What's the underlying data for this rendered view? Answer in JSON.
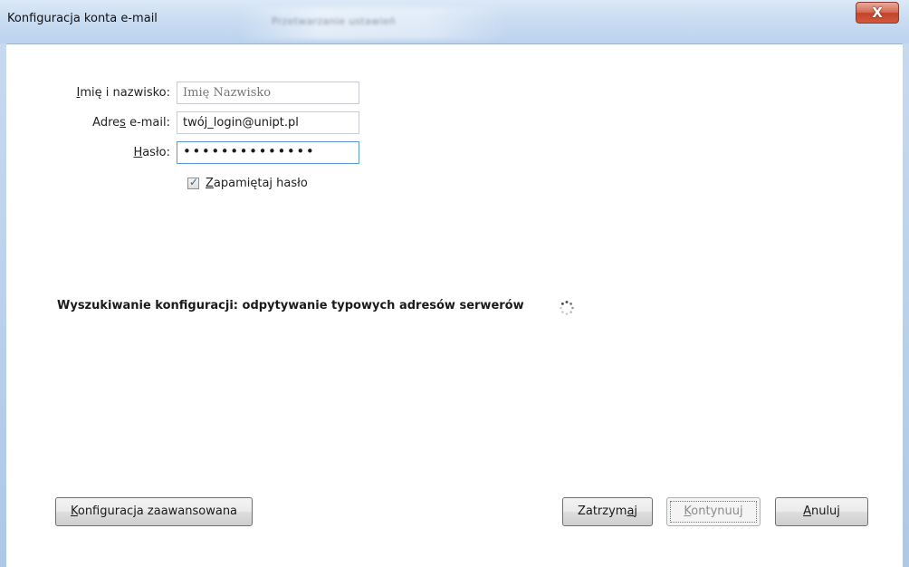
{
  "window": {
    "title": "Konfiguracja konta e-mail",
    "background_title": "Przetwarzanie ustawień",
    "close_glyph": "X"
  },
  "form": {
    "name": {
      "label": "Imię i nazwisko:",
      "value": "",
      "placeholder": "Imię Nazwisko"
    },
    "email": {
      "label": "Adres e-mail:",
      "value": "twój_login@unipt.pl"
    },
    "password": {
      "label": "Hasło:",
      "masked_value": "••••••••••••••"
    },
    "remember": {
      "label": "Zapamiętaj hasło",
      "checked": true
    }
  },
  "status": {
    "text": "Wyszukiwanie konfiguracji: odpytywanie typowych adresów serwerów"
  },
  "buttons": {
    "advanced": "Konfiguracja zaawansowana",
    "stop": "Zatrzymaj",
    "continue": "Kontynuuj",
    "cancel": "Anuluj"
  },
  "colors": {
    "titlebar": "#c9dcf2",
    "close": "#c4432a",
    "focus_border": "#5b9bd5"
  }
}
